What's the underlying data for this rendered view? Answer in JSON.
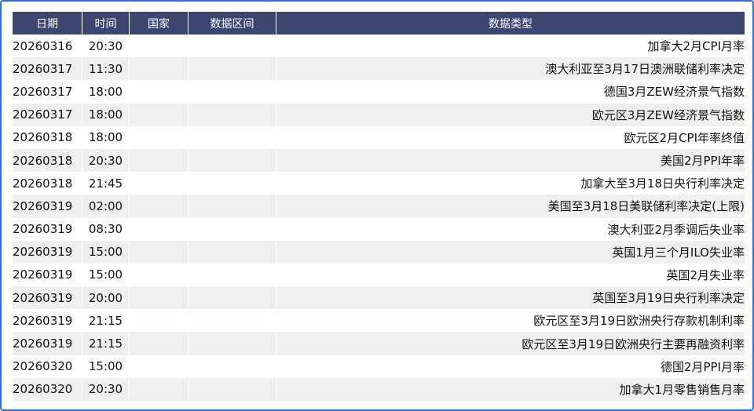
{
  "columns": [
    "日期",
    "时间",
    "国家",
    "数据区间",
    "数据类型"
  ],
  "rows": [
    {
      "date": "20260316",
      "time": "20:30",
      "country": "",
      "period": "",
      "type": "加拿大2月CPI月率"
    },
    {
      "date": "20260317",
      "time": "11:30",
      "country": "",
      "period": "",
      "type": "澳大利亚至3月17日澳洲联储利率决定"
    },
    {
      "date": "20260317",
      "time": "18:00",
      "country": "",
      "period": "",
      "type": "德国3月ZEW经济景气指数"
    },
    {
      "date": "20260317",
      "time": "18:00",
      "country": "",
      "period": "",
      "type": "欧元区3月ZEW经济景气指数"
    },
    {
      "date": "20260318",
      "time": "18:00",
      "country": "",
      "period": "",
      "type": "欧元区2月CPI年率终值"
    },
    {
      "date": "20260318",
      "time": "20:30",
      "country": "",
      "period": "",
      "type": "美国2月PPI年率"
    },
    {
      "date": "20260318",
      "time": "21:45",
      "country": "",
      "period": "",
      "type": "加拿大至3月18日央行利率决定"
    },
    {
      "date": "20260319",
      "time": "02:00",
      "country": "",
      "period": "",
      "type": "美国至3月18日美联储利率决定(上限)"
    },
    {
      "date": "20260319",
      "time": "08:30",
      "country": "",
      "period": "",
      "type": "澳大利亚2月季调后失业率"
    },
    {
      "date": "20260319",
      "time": "15:00",
      "country": "",
      "period": "",
      "type": "英国1月三个月ILO失业率"
    },
    {
      "date": "20260319",
      "time": "15:00",
      "country": "",
      "period": "",
      "type": "英国2月失业率"
    },
    {
      "date": "20260319",
      "time": "20:00",
      "country": "",
      "period": "",
      "type": "英国至3月19日央行利率决定"
    },
    {
      "date": "20260319",
      "time": "21:15",
      "country": "",
      "period": "",
      "type": "欧元区至3月19日欧洲央行存款机制利率"
    },
    {
      "date": "20260319",
      "time": "21:15",
      "country": "",
      "period": "",
      "type": "欧元区至3月19日欧洲央行主要再融资利率"
    },
    {
      "date": "20260320",
      "time": "15:00",
      "country": "",
      "period": "",
      "type": "德国2月PPI月率"
    },
    {
      "date": "20260320",
      "time": "20:30",
      "country": "",
      "period": "",
      "type": "加拿大1月零售销售月率"
    }
  ],
  "colors": {
    "header_bg": "#3c4670",
    "header_text": "#ffffff",
    "row_alt_bg": "#eeeff1",
    "frame_border": "#2a6fdb"
  }
}
